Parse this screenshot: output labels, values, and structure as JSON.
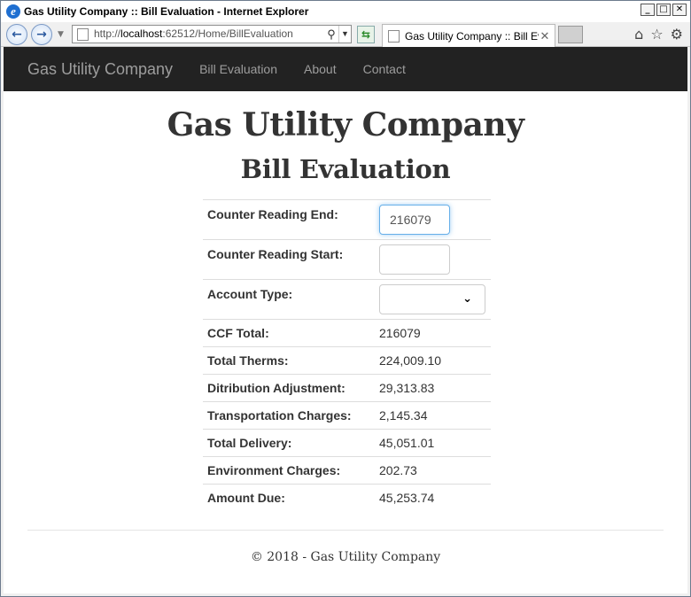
{
  "window": {
    "title": "Gas Utility Company :: Bill Evaluation - Internet Explorer",
    "buttons": {
      "minimize": "_",
      "maximize": "□",
      "close": "✕"
    }
  },
  "browser": {
    "back_icon": "back-arrow-icon",
    "forward_icon": "forward-arrow-icon",
    "address_prefix": "http://",
    "address_host": "localhost",
    "address_rest": ":62512/Home/BillEvaluation",
    "tab_label": "Gas Utility Company :: Bill Ev...",
    "tab_close": "✕",
    "toolbar_icons": [
      "home-icon",
      "favorites-star-icon",
      "tools-gear-icon"
    ]
  },
  "site_nav": {
    "brand": "Gas Utility Company",
    "links": [
      "Bill Evaluation",
      "About",
      "Contact"
    ]
  },
  "main": {
    "heading": "Gas Utility Company",
    "subheading": "Bill Evaluation",
    "form": {
      "counter_end_label": "Counter Reading End:",
      "counter_end_value": "216079",
      "counter_start_label": "Counter Reading Start:",
      "counter_start_value": "",
      "account_type_label": "Account Type:",
      "account_type_value": ""
    },
    "results": [
      {
        "label": "CCF Total:",
        "value": "216079"
      },
      {
        "label": "Total Therms:",
        "value": "224,009.10"
      },
      {
        "label": "Ditribution Adjustment:",
        "value": "29,313.83"
      },
      {
        "label": "Transportation Charges:",
        "value": "2,145.34"
      },
      {
        "label": "Total Delivery:",
        "value": "45,051.01"
      },
      {
        "label": "Environment Charges:",
        "value": "202.73"
      },
      {
        "label": "Amount Due:",
        "value": "45,253.74"
      }
    ]
  },
  "footer": {
    "text": "© 2018 - Gas Utility Company"
  }
}
